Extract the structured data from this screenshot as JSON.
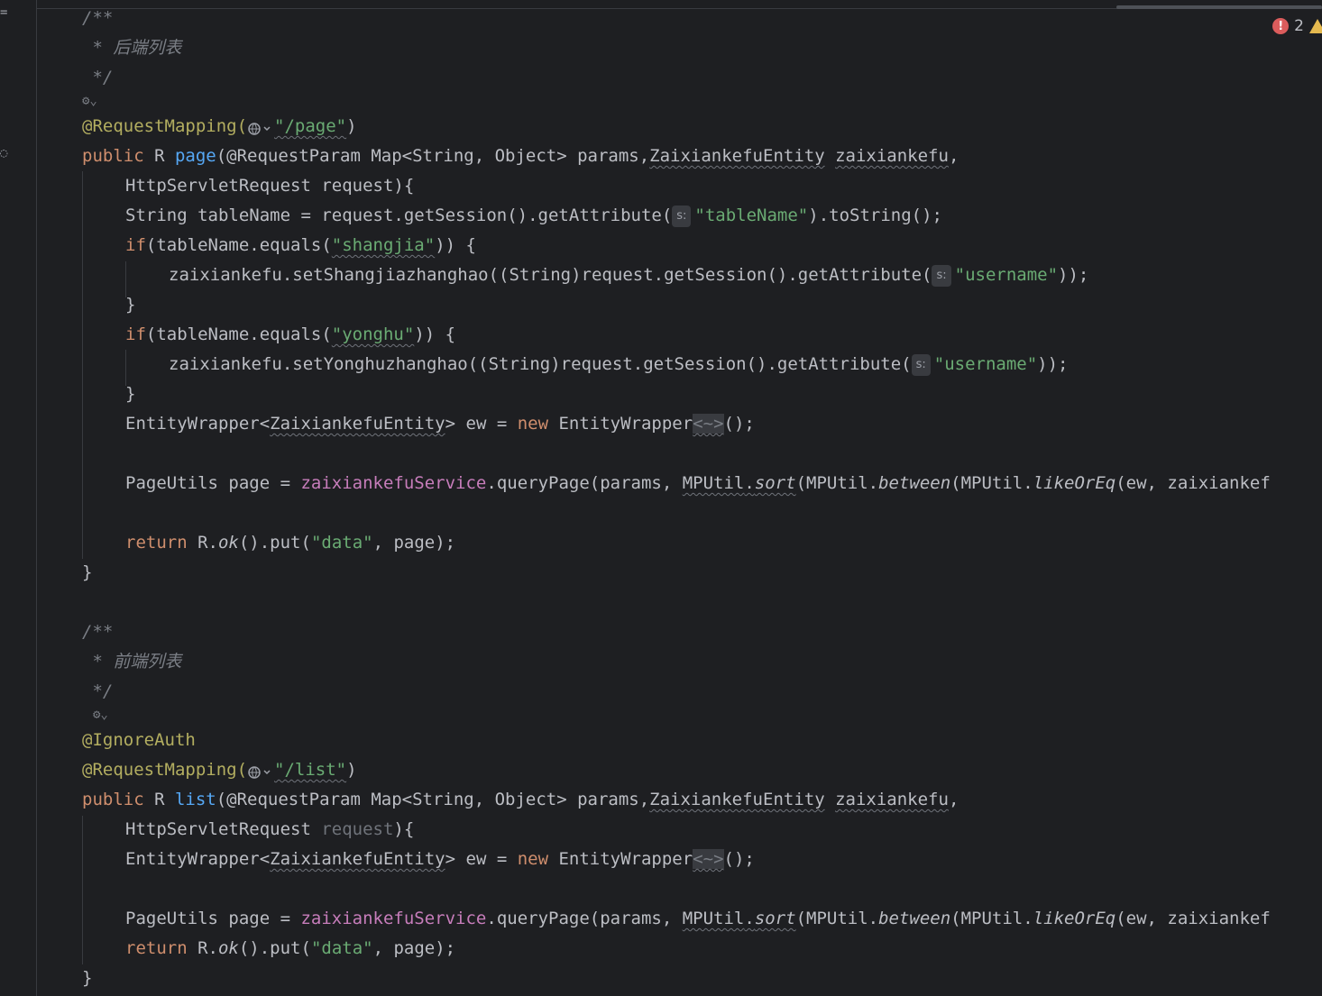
{
  "inspection": {
    "errors": "2"
  },
  "code": {
    "doc1_open": "/**",
    "doc1_text": " * 后端列表",
    "doc1_close": " */",
    "l_reqmap1_a": "@RequestMapping(",
    "l_reqmap1_path": "\"/page\"",
    "l_reqmap1_b": ")",
    "page_sig_public": "public",
    "page_sig_R": " R ",
    "page_sig_name": "page",
    "page_sig_rest1": "(@RequestParam Map<String, Object> params,",
    "page_sig_entity": "ZaixiankefuEntity",
    "page_sig_sp": " ",
    "page_sig_var": "zaixiankefu",
    "page_sig_end": ",",
    "l_httpreq1": "HttpServletRequest request){",
    "l_tablename_a": "String tableName = request.getSession().getAttribute(",
    "hint_s": "s:",
    "l_tablename_str": "\"tableName\"",
    "l_tablename_b": ").toString();",
    "if1_kw": "if",
    "if1_a": "(tableName.equals(",
    "if1_str": "\"shangjia\"",
    "if1_b": ")) {",
    "set1_a": "zaixiankefu.setShangjiazhanghao((String)request.getSession().getAttribute(",
    "str_username": "\"username\"",
    "set_end": "));",
    "close_brace": "}",
    "if2_kw": "if",
    "if2_a": "(tableName.equals(",
    "if2_str": "\"yonghu\"",
    "if2_b": ")) {",
    "set2_a": "zaixiankefu.setYonghuzhanghao((String)request.getSession().getAttribute(",
    "ew_a": "EntityWrapper<",
    "ew_entity": "ZaixiankefuEntity",
    "ew_b": "> ew = ",
    "ew_new": "new",
    "ew_c": " EntityWrapper",
    "ew_diamond": "<~>",
    "ew_d": "();",
    "pu_a": "PageUtils page = ",
    "pu_svc": "zaixiankefuService",
    "pu_b": ".queryPage(params, ",
    "pu_mp": "MPUtil",
    "pu_dot": ".",
    "pu_sort": "sort",
    "pu_c": "(MPUtil.",
    "pu_between": "between",
    "pu_d": "(MPUtil.",
    "pu_like": "likeOrEq",
    "pu_e": "(ew, zaixiankef",
    "ret_kw": "return",
    "ret_a": " R.",
    "ret_ok": "ok",
    "ret_b": "().put(",
    "ret_str": "\"data\"",
    "ret_c": ", page);",
    "doc2_open": "/**",
    "doc2_text": " * 前端列表",
    "doc2_close": " */",
    "ignore_auth": "@IgnoreAuth",
    "l_reqmap2_path": "\"/list\"",
    "list_sig_name": "list",
    "l_httpreq2_a": "HttpServletRequest ",
    "l_httpreq2_req": "request",
    "l_httpreq2_b": "){"
  }
}
